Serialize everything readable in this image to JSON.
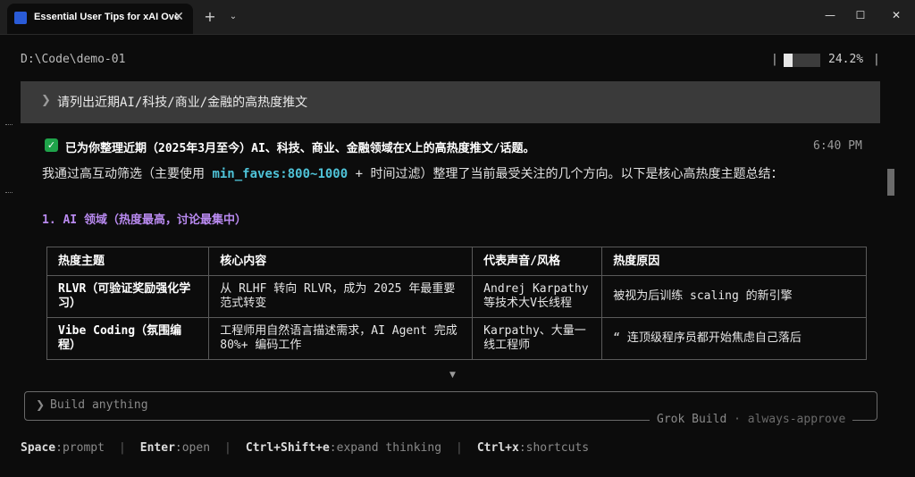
{
  "window": {
    "tab_title": "Essential User Tips for xAI Ove",
    "new_tab_label": "+",
    "dropdown_label": "⌄",
    "close_tab_label": "✕",
    "minimize_label": "—",
    "maximize_label": "☐",
    "close_label": "✕"
  },
  "terminal": {
    "cwd": "D:\\Code\\demo-01",
    "progress_text": "24.2%",
    "progress_fraction": 0.242,
    "bar_sep": "|",
    "prompt_chevron": "❯",
    "prompt_text": "请列出近期AI/科技/商业/金融的高热度推文",
    "response_heading": "已为你整理近期（2025年3月至今）AI、科技、商业、金融领域在X上的高热度推文/话题。",
    "timestamp": "6:40 PM",
    "para_part1": "我通过高互动筛选（主要使用 ",
    "para_highlight": "min_faves:800~1000",
    "para_part2": " + 时间过滤）整理了当前最受关注的几个方向。以下是核心高热度主题总结：",
    "section_heading": "1. AI 领域（热度最高，讨论最集中）",
    "table": {
      "headers": [
        "热度主题",
        "核心内容",
        "代表声音/风格",
        "热度原因"
      ],
      "rows": [
        [
          "RLVR（可验证奖励强化学习）",
          "从 RLHF 转向 RLVR，成为 2025 年最重要范式转变",
          "Andrej Karpathy 等技术大V长线程",
          "被视为后训练 scaling 的新引擎"
        ],
        [
          "Vibe Coding（氛围编程）",
          "工程师用自然语言描述需求，AI Agent 完成 80%+ 编码工作",
          "Karpathy、大量一线工程师",
          "“ 连顶级程序员都开始焦虑自己落后"
        ]
      ]
    },
    "more_indicator": "▼",
    "input": {
      "chevron": "❯",
      "placeholder": "Build anything",
      "legend_main": "Grok Build",
      "legend_sep": " · ",
      "legend_mode": "always-approve"
    },
    "shortcuts": [
      {
        "key": "Space",
        "desc": "prompt"
      },
      {
        "key": "Enter",
        "desc": "open"
      },
      {
        "key": "Ctrl+Shift+e",
        "desc": "expand thinking"
      },
      {
        "key": "Ctrl+x",
        "desc": "shortcuts"
      }
    ],
    "shortcut_sep": "|"
  },
  "colors": {
    "accent_cyan": "#4fc3d8",
    "section_purple": "#b98af0",
    "check_green": "#1fa34a"
  }
}
